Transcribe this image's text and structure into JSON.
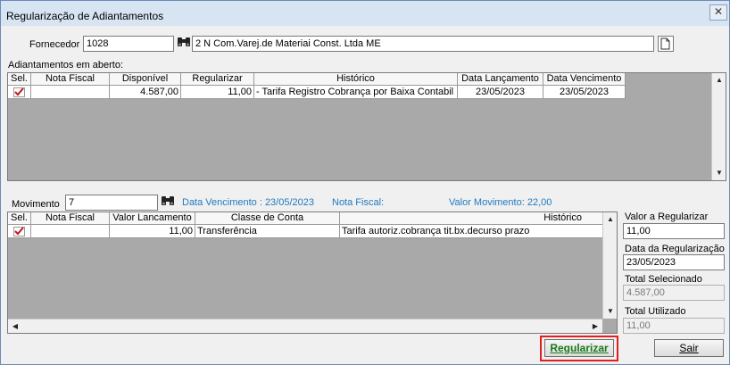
{
  "window": {
    "title": "Regularização de Adiantamentos",
    "close_glyph": "✕"
  },
  "fornecedor": {
    "label": "Fornecedor",
    "code": "1028",
    "name": "2 N Com.Varej.de Materiai Const. Ltda ME"
  },
  "adiantamentos": {
    "section_label": "Adiantamentos em aberto:",
    "columns": [
      "Sel.",
      "Nota Fiscal",
      "Disponível",
      "Regularizar",
      "Histórico",
      "Data Lançamento",
      "Data Vencimento"
    ],
    "rows": [
      {
        "selected": true,
        "nota_fiscal": "",
        "disponivel": "4.587,00",
        "regularizar": "11,00",
        "historico": "- Tarifa Registro Cobrança por Baixa Contabil",
        "data_lancamento": "23/05/2023",
        "data_vencimento": "23/05/2023"
      }
    ]
  },
  "movimento": {
    "label": "Movimento",
    "value": "7",
    "data_vencimento": "Data Vencimento : 23/05/2023",
    "nota_fiscal": "Nota Fiscal:",
    "valor_movimento": "Valor Movimento: 22,00",
    "columns": [
      "Sel.",
      "Nota Fiscal",
      "Valor Lancamento",
      "Classe de Conta",
      "Histórico"
    ],
    "rows": [
      {
        "selected": true,
        "nota_fiscal": "",
        "valor_lancamento": "11,00",
        "classe_conta": "Transferência",
        "historico": "Tarifa autoriz.cobrança tit.bx.decurso prazo"
      }
    ]
  },
  "side": {
    "valor_regularizar_label": "Valor a Regularizar",
    "valor_regularizar": "11,00",
    "data_regularizacao_label": "Data da Regularização",
    "data_regularizacao": "23/05/2023",
    "total_selecionado_label": "Total Selecionado",
    "total_selecionado": "4.587,00",
    "total_utilizado_label": "Total Utilizado",
    "total_utilizado": "11,00"
  },
  "buttons": {
    "regularizar": "Regularizar",
    "sair": "Sair"
  },
  "colors": {
    "highlight_border": "#e0201c",
    "regularizar_text": "#1a7a1a",
    "info_text": "#1f7ac0",
    "checkmark": "#c0181f"
  }
}
